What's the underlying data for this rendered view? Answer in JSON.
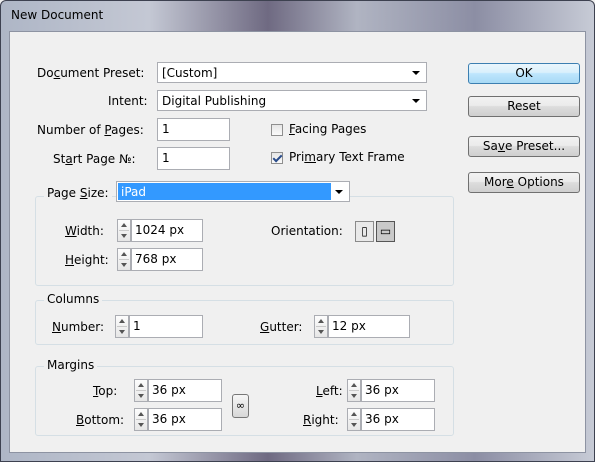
{
  "window": {
    "title": "New Document"
  },
  "preset": {
    "label_pre": "Do",
    "label_u": "c",
    "label_post": "ument Preset:",
    "value": "[Custom]"
  },
  "intent": {
    "label": "Intent:",
    "value": "Digital Publishing"
  },
  "pages": {
    "label_pre": "Number of ",
    "label_u": "P",
    "label_post": "ages:",
    "value": "1"
  },
  "start_page": {
    "label_pre": "St",
    "label_u": "a",
    "label_post": "rt Page №:",
    "value": "1"
  },
  "facing_pages": {
    "label_u": "F",
    "label_post": "acing Pages",
    "checked": false
  },
  "primary_text_frame": {
    "label_pre": "Pri",
    "label_u": "m",
    "label_post": "ary Text Frame",
    "checked": true
  },
  "buttons": {
    "ok": "OK",
    "reset": "Reset",
    "save_pre": "Sa",
    "save_u": "v",
    "save_post": "e Preset...",
    "more_pre": "Mor",
    "more_u": "e",
    "more_post": " Options"
  },
  "page_size": {
    "label_pre": "Page ",
    "label_u": "S",
    "label_post": "ize:",
    "value": "iPad",
    "width_u": "W",
    "width_post": "idth:",
    "width_value": "1024 px",
    "height_u": "H",
    "height_post": "eight:",
    "height_value": "768 px",
    "orientation_label": "Orientation:",
    "orientation_selected": "landscape"
  },
  "columns": {
    "title": "Columns",
    "number_u": "N",
    "number_post": "umber:",
    "number_value": "1",
    "gutter_u": "G",
    "gutter_post": "utter:",
    "gutter_value": "12 px"
  },
  "margins": {
    "title": "Margins",
    "top_u": "T",
    "top_post": "op:",
    "top_value": "36 px",
    "bottom_u": "B",
    "bottom_post": "ottom:",
    "bottom_value": "36 px",
    "left_u": "L",
    "left_post": "eft:",
    "left_value": "36 px",
    "right_u": "R",
    "right_post": "ight:",
    "right_value": "36 px"
  },
  "icons": {
    "portrait": "portrait-page-icon",
    "landscape": "landscape-page-icon",
    "link": "chain-link-icon"
  }
}
